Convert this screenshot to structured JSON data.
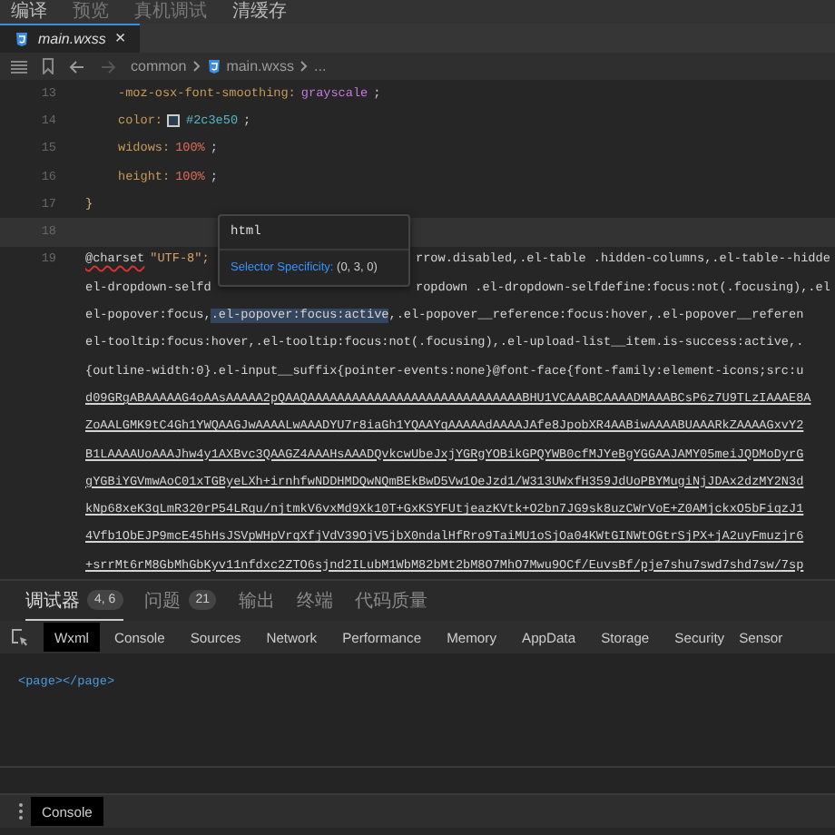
{
  "menu": [
    {
      "label": "编译",
      "disabled": false
    },
    {
      "label": "预览",
      "disabled": true
    },
    {
      "label": "真机调试",
      "disabled": true
    },
    {
      "label": "清缓存",
      "disabled": false
    }
  ],
  "editor_tabs": [
    {
      "label": "main.wxss",
      "selected": true,
      "close": "×"
    }
  ],
  "breadcrumb": {
    "forward_disabled": true,
    "items": [
      "common",
      "main.wxss",
      "..."
    ]
  },
  "code": {
    "lines": [
      {
        "number": "13",
        "indented": true,
        "current": false,
        "tokens": [
          {
            "kind": "prop",
            "text": "-moz-osx-font-smoothing:"
          },
          {
            "kind": "keyword",
            "text": "grayscale"
          },
          {
            "kind": "punct",
            "text": ";"
          }
        ]
      },
      {
        "number": "14",
        "indented": true,
        "current": false,
        "tokens": [
          {
            "kind": "prop",
            "text": "color:"
          },
          {
            "kind": "swatch",
            "color": "#2c3e50"
          },
          {
            "kind": "color",
            "text": "#2c3e50"
          },
          {
            "kind": "punct",
            "text": ";"
          }
        ]
      },
      {
        "number": "15",
        "indented": true,
        "current": false,
        "tokens": [
          {
            "kind": "prop",
            "text": "widows:"
          },
          {
            "kind": "number",
            "text": "100%"
          },
          {
            "kind": "punct",
            "text": ";"
          }
        ]
      },
      {
        "number": "16",
        "indented": true,
        "current": false,
        "tokens": [
          {
            "kind": "prop",
            "text": "height:"
          },
          {
            "kind": "number",
            "text": "100%"
          },
          {
            "kind": "punct",
            "text": ";"
          }
        ]
      },
      {
        "number": "17",
        "indented": false,
        "current": false,
        "tokens": [
          {
            "kind": "brace",
            "text": "}"
          }
        ]
      },
      {
        "number": "18",
        "indented": false,
        "current": true
      },
      {
        "number": "19",
        "current": false,
        "squiggle": true,
        "tokens": [
          {
            "kind": "plain",
            "text": "@charset"
          },
          {
            "kind": "string",
            "text": "\"UTF-8\";"
          }
        ],
        "rest": "rrow.disabled,.el-table .hidden-columns,.el-table--hidde"
      }
    ],
    "wrapped": [
      {
        "underlined": false,
        "segments": [
          {
            "text": "el-dropdown-selfd",
            "selected": false
          }
        ],
        "rest": "ropdown .el-dropdown-selfdefine:focus:not(.focusing),.el"
      },
      {
        "underlined": false,
        "segments": [
          {
            "text": "el-popover:focus,",
            "selected": false
          },
          {
            "text": ".el-popover:focus:active",
            "selected": true
          },
          {
            "text": ",.el-popover__reference:focus:hover,.el-popover__referen",
            "selected": false
          }
        ]
      },
      {
        "underlined": false,
        "segments": [
          {
            "text": "el-tooltip:focus:hover,.el-tooltip:focus:not(.focusing),.el-upload-list__item.is-success:active,.",
            "selected": false
          }
        ]
      },
      {
        "underlined": false,
        "segments": [
          {
            "text": "{outline-width:0}.el-input__suffix{pointer-events:none}@font-face{font-family:element-icons;src:u",
            "selected": false
          }
        ]
      },
      {
        "underlined": true,
        "segments": [
          {
            "text": "d09GRgABAAAAAG4oAAsAAAAA2pQAAQAAAAAAAAAAAAAAAAAAAAAAAAAAAAABHU1VCAAABCAAAADMAAABCsP6z7U9TLzIAAAE8A",
            "selected": false
          }
        ]
      },
      {
        "underlined": true,
        "segments": [
          {
            "text": "ZoAALGMK9tC4Gh1YWQAAGJwAAAALwAAADYU7r8iaGh1YQAAYqAAAAAdAAAAJAfe8JpobXR4AABiwAAAABUAAARkZAAAAGxvY2",
            "selected": false
          }
        ]
      },
      {
        "underlined": true,
        "segments": [
          {
            "text": "B1LAAAAUoAAAJhw4y1AXBvc3QAAGZ4AAAHsAAADQvkcwUbeJxjYGRgYOBikGPQYWB0cfMJYeBgYGGAAJAMY05meiJQDMoDyrG",
            "selected": false
          }
        ]
      },
      {
        "underlined": true,
        "segments": [
          {
            "text": "gYGBiYGVmwAoC01xTGByeLXh+irnhfwNDDHMDQwNQmBEkBwD5Vw1OeJzd1/W313UWxfH359JdUoPBYMugiNjJDAx2dzMY2N3d",
            "selected": false
          }
        ]
      },
      {
        "underlined": true,
        "segments": [
          {
            "text": "kNp68xeK3qLmR320rP54LRqu/njtmkV6vxMd9Xk10T+GxKSYFUtjeazKVtk+O2bn7JG9sk8uzCWrVoE+Z0AMjckxO5bFiqzJ1",
            "selected": false
          }
        ]
      },
      {
        "underlined": true,
        "segments": [
          {
            "text": "4Vfb1ObEJP9mcE45hHsJSVpWHpVrqXfjVdV39OjV5jbX0ndalHfRro9TaiMU1oSjOa04KWtGINWtOGtrSjPX+jA2uyFmuzjr6",
            "selected": false
          }
        ]
      },
      {
        "underlined": true,
        "segments": [
          {
            "text": "+srrMt6rM8GbMhGbKyv11nfdxc2ZTO6sjnd2ILubM1WbM82bMt2bM8O7MhO7Mwu9OCf/EuvsBf/pje7shu7swd7shd7sw/7sp",
            "selected": false
          }
        ]
      }
    ]
  },
  "tooltip": {
    "element": "html",
    "label": "Selector Specificity:",
    "value": "(0, 3, 0)"
  },
  "panel_tabs": [
    {
      "label": "调试器",
      "selected": true,
      "badge": "4, 6"
    },
    {
      "label": "问题",
      "selected": false,
      "badge": "21"
    },
    {
      "label": "输出",
      "selected": false
    },
    {
      "label": "终端",
      "selected": false
    },
    {
      "label": "代码质量",
      "selected": false
    }
  ],
  "devtools_tabs": [
    {
      "label": "Wxml",
      "selected": true
    },
    {
      "label": "Console",
      "selected": false
    },
    {
      "label": "Sources",
      "selected": false
    },
    {
      "label": "Network",
      "selected": false
    },
    {
      "label": "Performance",
      "selected": false
    },
    {
      "label": "Memory",
      "selected": false
    },
    {
      "label": "AppData",
      "selected": false
    },
    {
      "label": "Storage",
      "selected": false
    },
    {
      "label": "Security",
      "selected": false
    },
    {
      "label": "Sensor",
      "selected": false
    }
  ],
  "wxml_content": "<page></page>",
  "drawer_tabs": [
    {
      "label": "Console",
      "selected": true
    }
  ]
}
